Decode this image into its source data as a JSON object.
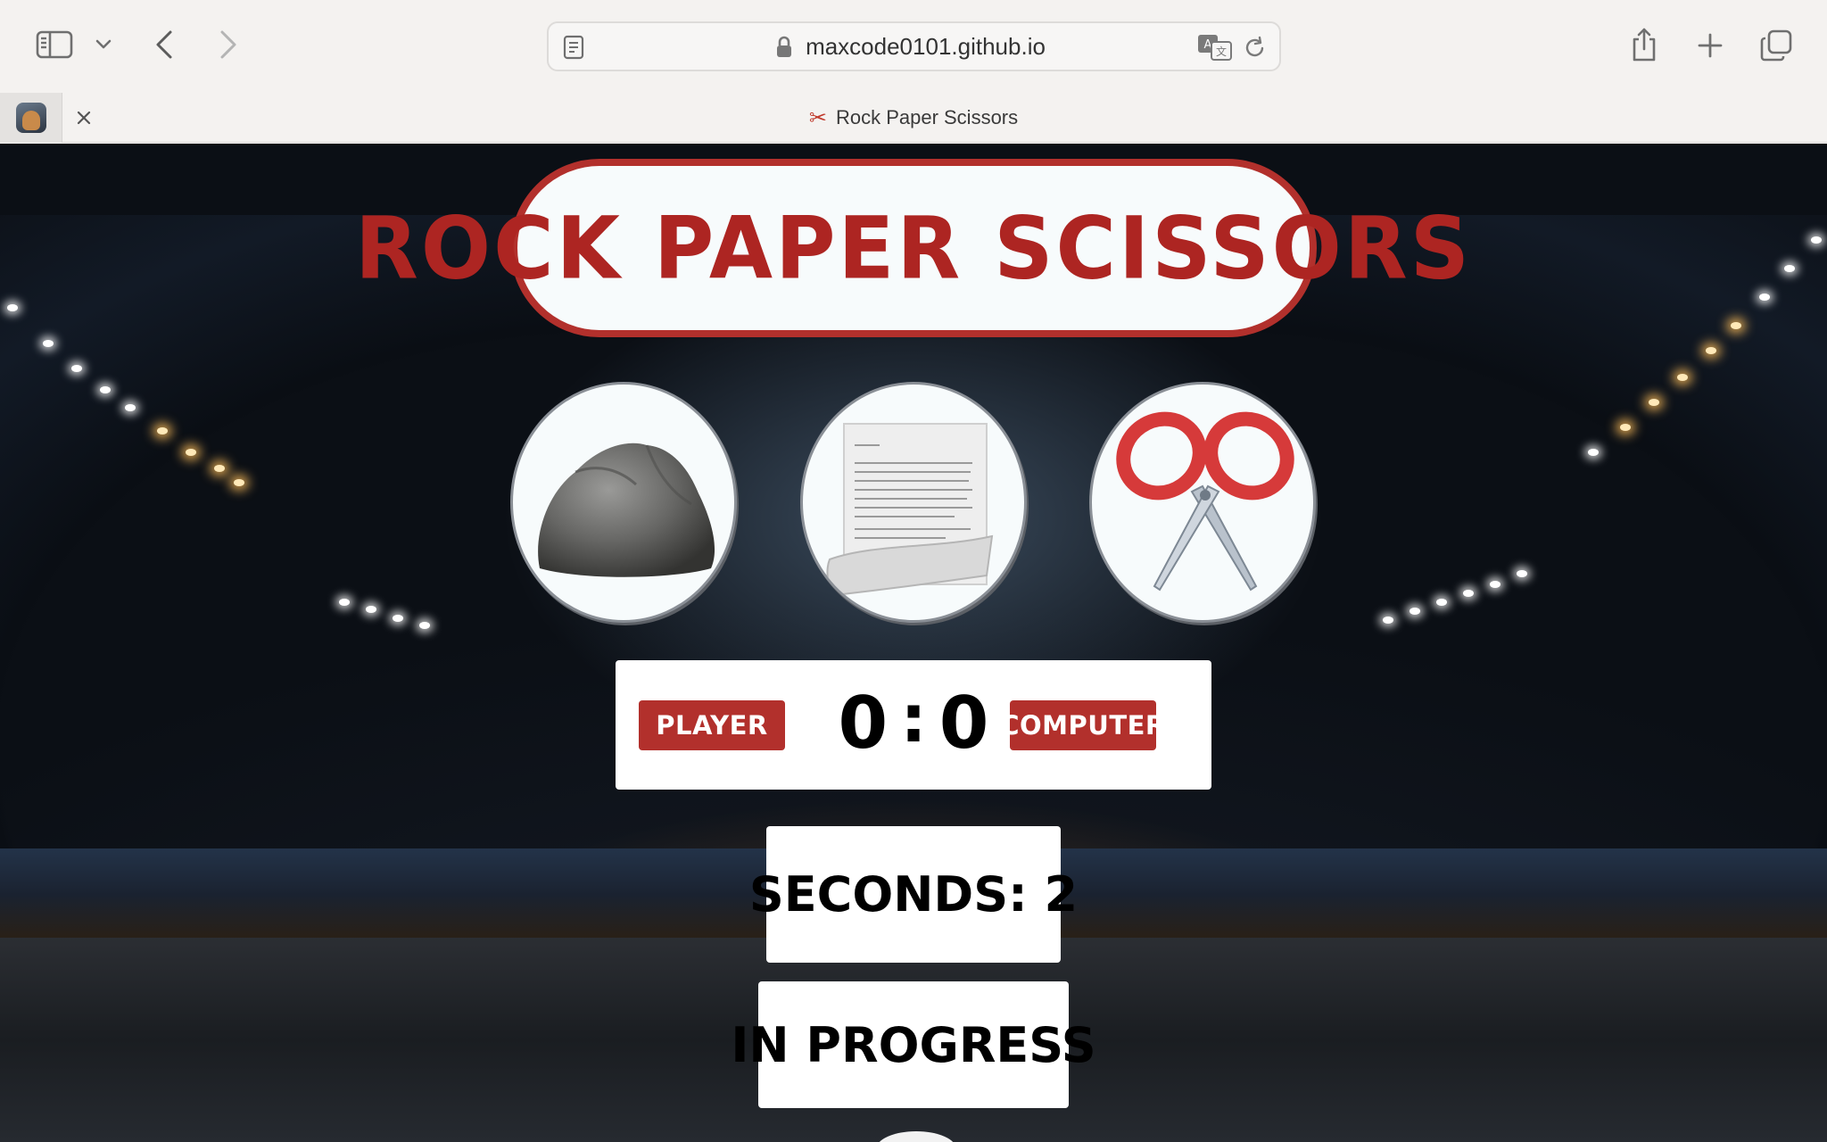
{
  "browser": {
    "url": "maxcode0101.github.io",
    "tab": {
      "title": "Rock Paper Scissors",
      "icon": "scissors-icon"
    }
  },
  "game": {
    "title": "ROCK PAPER SCISSORS",
    "choices": [
      {
        "name": "rock",
        "icon": "rock-image"
      },
      {
        "name": "paper",
        "icon": "paper-image"
      },
      {
        "name": "scissors",
        "icon": "scissors-image"
      }
    ],
    "scoreboard": {
      "player_label": "PLAYER",
      "computer_label": "COMPUTER",
      "player_score": "0",
      "separator": ":",
      "computer_score": "0"
    },
    "timer": {
      "text": "SECONDS: 2"
    },
    "status": "IN PROGRESS"
  },
  "colors": {
    "accent_red": "#b2302c",
    "panel_white": "#f7fbfc"
  }
}
